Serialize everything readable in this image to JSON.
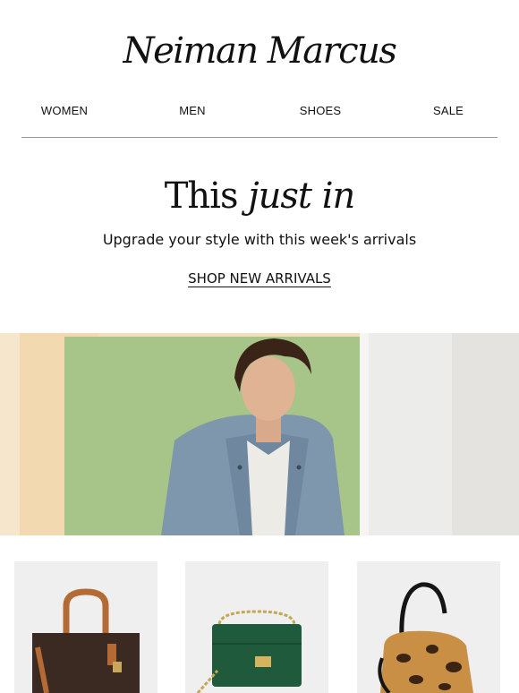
{
  "brand": {
    "logo_text": "Neiman Marcus"
  },
  "nav": {
    "items": [
      {
        "label": "WOMEN"
      },
      {
        "label": "MEN"
      },
      {
        "label": "SHOES"
      },
      {
        "label": "SALE"
      }
    ]
  },
  "hero": {
    "title_plain": "This",
    "title_italic": "just in",
    "subtitle": "Upgrade your style with this week's arrivals",
    "cta_label": "SHOP NEW ARRIVALS"
  },
  "banner": {
    "image": "model-in-suede-jacket-photo"
  },
  "products": [
    {
      "image": "brown-logo-tote-bag"
    },
    {
      "image": "green-croc-shoulder-bag"
    },
    {
      "image": "leopard-faux-fur-bucket-bag"
    }
  ],
  "colors": {
    "text": "#111111",
    "divider": "#9a9a9a",
    "banner_green": "#a7c489",
    "card_bg": "#efefef"
  }
}
